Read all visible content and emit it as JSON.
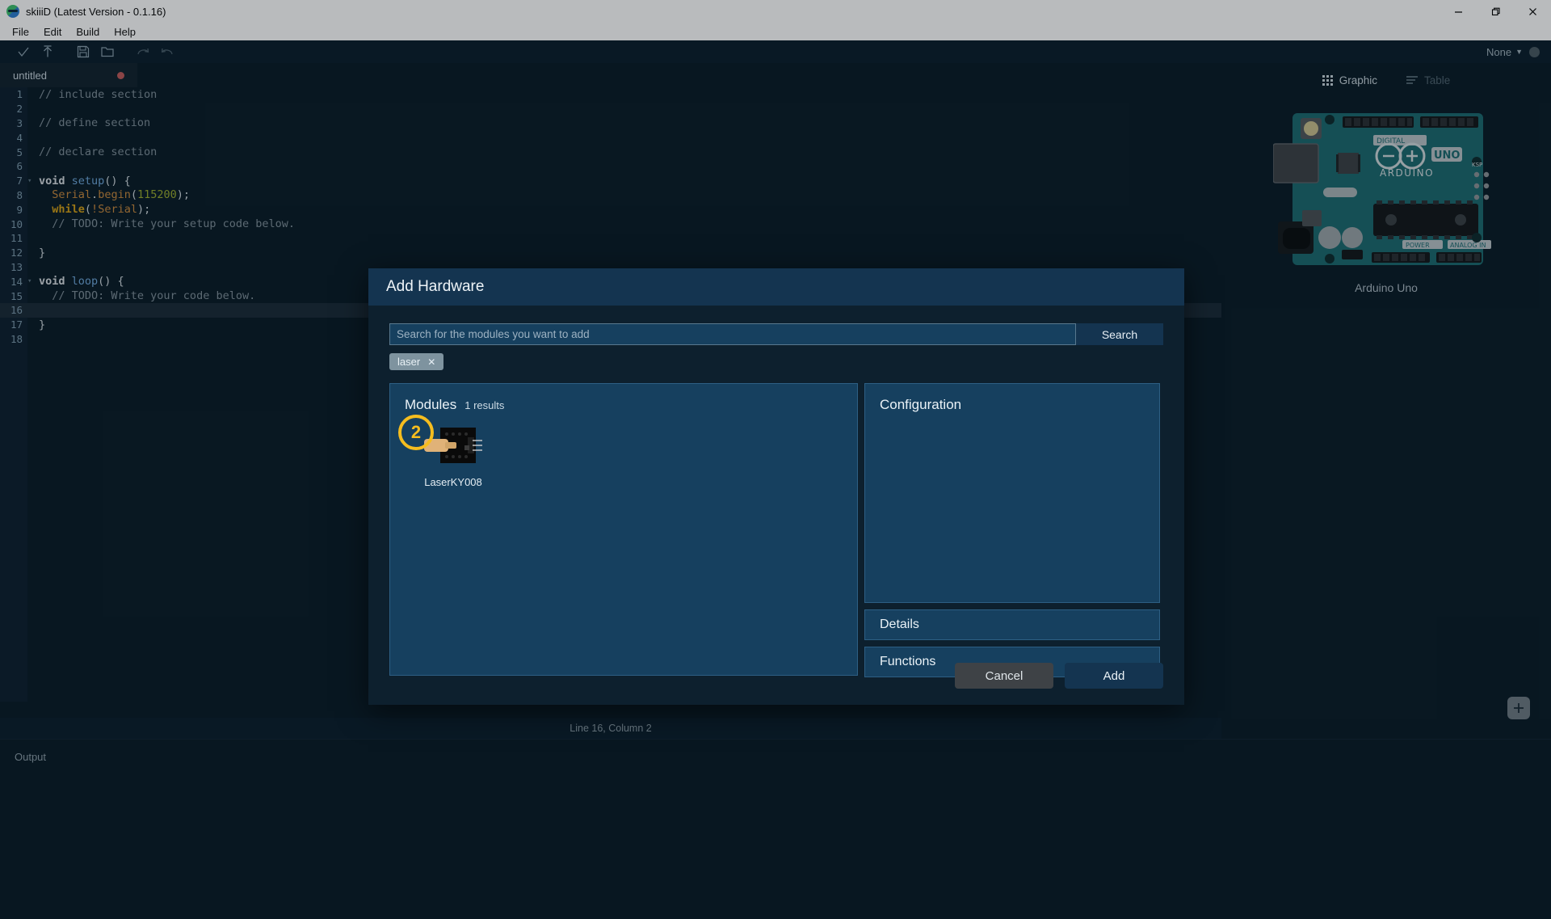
{
  "window": {
    "title": "skiiiD (Latest Version - 0.1.16)",
    "logo_icon": "skiiid-logo-icon",
    "controls": {
      "minimize": "minimize-icon",
      "restore": "restore-icon",
      "close": "close-icon"
    }
  },
  "menubar": {
    "items": [
      "File",
      "Edit",
      "Build",
      "Help"
    ]
  },
  "toolbar": {
    "icons": [
      "check-icon",
      "upload-icon",
      "save-icon",
      "folder-open-icon",
      "redo-icon",
      "undo-icon"
    ],
    "board_selector": {
      "value": "None",
      "caret": "chevron-down-icon"
    },
    "status_dot": "connection-status-dot"
  },
  "editor": {
    "tab": {
      "label": "untitled",
      "modified_dot": "unsaved-changes-dot"
    },
    "lines": [
      {
        "n": 1,
        "fold": false,
        "tokens": [
          {
            "t": "// include section",
            "c": "c-com"
          }
        ]
      },
      {
        "n": 2,
        "fold": false,
        "tokens": []
      },
      {
        "n": 3,
        "fold": false,
        "tokens": [
          {
            "t": "// define section",
            "c": "c-com"
          }
        ]
      },
      {
        "n": 4,
        "fold": false,
        "tokens": []
      },
      {
        "n": 5,
        "fold": false,
        "tokens": [
          {
            "t": "// declare section",
            "c": "c-com"
          }
        ]
      },
      {
        "n": 6,
        "fold": false,
        "tokens": []
      },
      {
        "n": 7,
        "fold": true,
        "tokens": [
          {
            "t": "void",
            "c": "c-kw"
          },
          {
            "t": " ",
            "c": "c-punc"
          },
          {
            "t": "setup",
            "c": "c-fn"
          },
          {
            "t": "() {",
            "c": "c-punc"
          }
        ]
      },
      {
        "n": 8,
        "fold": false,
        "tokens": [
          {
            "t": "  ",
            "c": "c-punc"
          },
          {
            "t": "Serial",
            "c": "c-id"
          },
          {
            "t": ".",
            "c": "c-punc"
          },
          {
            "t": "begin",
            "c": "c-id"
          },
          {
            "t": "(",
            "c": "c-punc"
          },
          {
            "t": "115200",
            "c": "c-num"
          },
          {
            "t": ");",
            "c": "c-punc"
          }
        ]
      },
      {
        "n": 9,
        "fold": false,
        "tokens": [
          {
            "t": "  ",
            "c": "c-punc"
          },
          {
            "t": "while",
            "c": "c-w"
          },
          {
            "t": "(",
            "c": "c-punc"
          },
          {
            "t": "!",
            "c": "c-op"
          },
          {
            "t": "Serial",
            "c": "c-id"
          },
          {
            "t": ");",
            "c": "c-punc"
          }
        ]
      },
      {
        "n": 10,
        "fold": false,
        "tokens": [
          {
            "t": "  // TODO: Write your setup code below.",
            "c": "c-com"
          }
        ]
      },
      {
        "n": 11,
        "fold": false,
        "tokens": []
      },
      {
        "n": 12,
        "fold": false,
        "tokens": [
          {
            "t": "}",
            "c": "c-punc"
          }
        ]
      },
      {
        "n": 13,
        "fold": false,
        "tokens": []
      },
      {
        "n": 14,
        "fold": true,
        "tokens": [
          {
            "t": "void",
            "c": "c-kw"
          },
          {
            "t": " ",
            "c": "c-punc"
          },
          {
            "t": "loop",
            "c": "c-fn"
          },
          {
            "t": "() {",
            "c": "c-punc"
          }
        ]
      },
      {
        "n": 15,
        "fold": false,
        "tokens": [
          {
            "t": "  // TODO: Write your code below.",
            "c": "c-com"
          }
        ]
      },
      {
        "n": 16,
        "fold": false,
        "active": true,
        "tokens": []
      },
      {
        "n": 17,
        "fold": false,
        "tokens": [
          {
            "t": "}",
            "c": "c-punc"
          }
        ]
      },
      {
        "n": 18,
        "fold": false,
        "tokens": []
      }
    ]
  },
  "statusbar": {
    "cursor": "Line 16, Column 2"
  },
  "output": {
    "label": "Output"
  },
  "sidebar": {
    "tabs": [
      {
        "label": "Graphic",
        "icon": "grid-icon",
        "active": true
      },
      {
        "label": "Table",
        "icon": "list-icon",
        "active": false
      }
    ],
    "board": {
      "name": "Arduino Uno",
      "image": "arduino-uno-board-image"
    },
    "add_button_icon": "plus-icon"
  },
  "dialog": {
    "title": "Add Hardware",
    "search": {
      "placeholder": "Search for the modules you want to add",
      "value": "",
      "button_label": "Search"
    },
    "tags": [
      {
        "label": "laser",
        "remove_icon": "close-icon"
      }
    ],
    "modules_pane": {
      "heading": "Modules",
      "count_label": "1 results",
      "items": [
        {
          "name": "LaserKY008",
          "thumbnail": "laser-ky008-module-image"
        }
      ]
    },
    "configuration_pane": {
      "heading": "Configuration",
      "content": ""
    },
    "accordions": [
      {
        "label": "Details"
      },
      {
        "label": "Functions"
      }
    ],
    "footer": {
      "cancel_label": "Cancel",
      "add_label": "Add"
    }
  },
  "annotation": {
    "step_number": "2",
    "color": "#f5bd1f"
  }
}
